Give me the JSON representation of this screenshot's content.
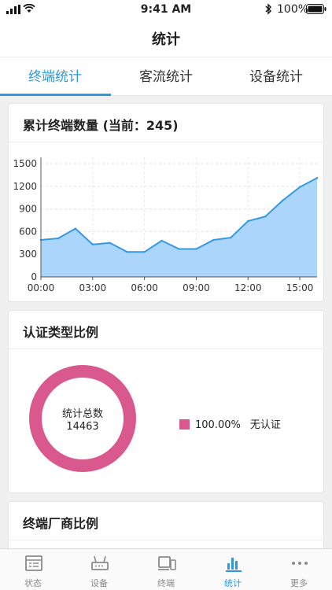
{
  "status_bar": {
    "time": "9:41 AM",
    "battery": "100%"
  },
  "nav": {
    "title": "统计"
  },
  "tabs": [
    {
      "label": "终端统计",
      "active": true
    },
    {
      "label": "客流统计",
      "active": false
    },
    {
      "label": "设备统计",
      "active": false
    }
  ],
  "terminal_card": {
    "title": "累计终端数量 (当前：245)"
  },
  "chart_data": {
    "type": "area",
    "x": [
      "00:00",
      "01:00",
      "02:00",
      "03:00",
      "04:00",
      "05:00",
      "06:00",
      "07:00",
      "08:00",
      "09:00",
      "10:00",
      "11:00",
      "12:00",
      "13:00",
      "14:00",
      "15:00",
      "16:00"
    ],
    "x_tick_labels": [
      "00:00",
      "03:00",
      "06:00",
      "09:00",
      "12:00",
      "15:00"
    ],
    "series": [
      {
        "values": [
          490,
          510,
          640,
          430,
          450,
          330,
          330,
          480,
          370,
          370,
          490,
          520,
          740,
          800,
          1010,
          1190,
          1310
        ]
      }
    ],
    "ylim": [
      0,
      1500
    ],
    "y_ticks": [
      0,
      300,
      600,
      900,
      1200,
      1500
    ],
    "grid": true,
    "line_color": "#3399e6",
    "fill_color": "#abd5fb"
  },
  "auth_card": {
    "title": "认证类型比例",
    "center_label": "统计总数",
    "total": "14463",
    "legend": [
      {
        "percent": "100.00%",
        "label": "无认证",
        "color": "#d9598f"
      }
    ]
  },
  "vendor_card": {
    "title": "终端厂商比例"
  },
  "tabbar": [
    {
      "label": "状态",
      "icon": "status-icon",
      "active": false
    },
    {
      "label": "设备",
      "icon": "router-icon",
      "active": false
    },
    {
      "label": "终端",
      "icon": "devices-icon",
      "active": false
    },
    {
      "label": "统计",
      "icon": "bar-chart-icon",
      "active": true
    },
    {
      "label": "更多",
      "icon": "more-icon",
      "active": false
    }
  ],
  "colors": {
    "accent": "#2b98e0",
    "donut": "#d9598f"
  }
}
